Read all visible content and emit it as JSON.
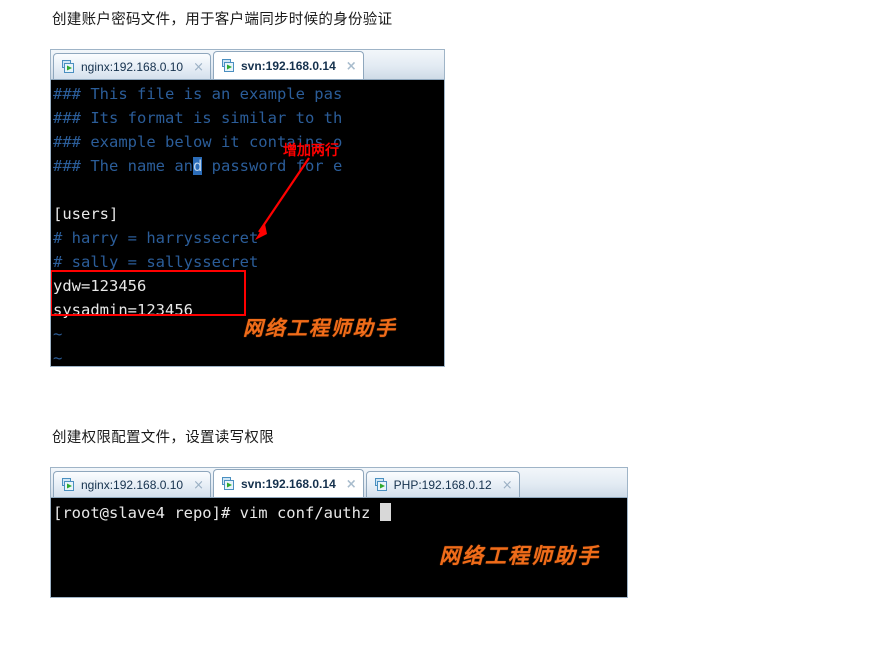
{
  "document": {
    "heading_one": "创建账户密码文件，用于客户端同步时候的身份验证",
    "heading_two": "创建权限配置文件，设置读写权限"
  },
  "terminal_one": {
    "tabs": [
      {
        "label": "nginx:192.168.0.10",
        "active": false,
        "close": "×",
        "icon": "remote-session-icon"
      },
      {
        "label": "svn:192.168.0.14",
        "active": true,
        "close": "×",
        "icon": "remote-session-icon"
      }
    ],
    "lines": [
      {
        "text": "### This file is an example pas",
        "style": "comment"
      },
      {
        "text": "### Its format is similar to th",
        "style": "comment"
      },
      {
        "text": "### example below it contains o",
        "style": "comment"
      },
      {
        "text": "### The name an",
        "style": "comment",
        "cursor_char": "d",
        "after": " password for e"
      },
      {
        "text": "",
        "style": "blank"
      },
      {
        "text": "[users]",
        "style": "white"
      },
      {
        "text": "# harry = harryssecret",
        "style": "comment"
      },
      {
        "text": "# sally = sallyssecret",
        "style": "comment"
      },
      {
        "text": "ydw=123456",
        "style": "white"
      },
      {
        "text": "sysadmin=123456",
        "style": "white"
      },
      {
        "text": "~",
        "style": "tilde"
      },
      {
        "text": "~",
        "style": "tilde"
      }
    ],
    "annotation": {
      "label": "增加两行",
      "box_color": "#ff0000",
      "arrow_color": "#ff0000"
    },
    "watermark": "网络工程师助手"
  },
  "terminal_two": {
    "tabs": [
      {
        "label": "nginx:192.168.0.10",
        "active": false,
        "close": "×",
        "icon": "remote-session-icon"
      },
      {
        "label": "svn:192.168.0.14",
        "active": true,
        "close": "×",
        "icon": "remote-session-icon"
      },
      {
        "label": "PHP:192.168.0.12",
        "active": false,
        "close": "×",
        "icon": "remote-session-icon"
      }
    ],
    "prompt_line": "[root@slave4 repo]# vim conf/authz ",
    "watermark": "网络工程师助手"
  },
  "colors": {
    "terminal_background": "#000000",
    "comment_text": "#2b5d99",
    "normal_text": "#e8e8e8",
    "annotation_red": "#ff0000",
    "watermark_orange": "#ef6c1a",
    "tab_border": "#8fa7bd"
  }
}
